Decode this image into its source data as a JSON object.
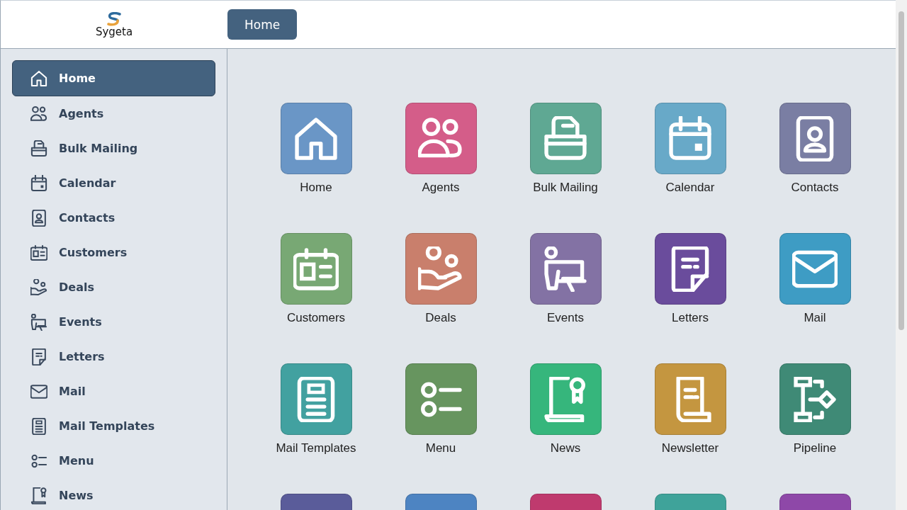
{
  "header": {
    "logo_text": "Sygeta",
    "button": "Home"
  },
  "sidebar": {
    "items": [
      {
        "label": "Home",
        "kind": "home",
        "selected": true
      },
      {
        "label": "Agents",
        "kind": "agents",
        "selected": false
      },
      {
        "label": "Bulk Mailing",
        "kind": "bulk_mailing",
        "selected": false
      },
      {
        "label": "Calendar",
        "kind": "calendar",
        "selected": false
      },
      {
        "label": "Contacts",
        "kind": "contacts",
        "selected": false
      },
      {
        "label": "Customers",
        "kind": "customers",
        "selected": false
      },
      {
        "label": "Deals",
        "kind": "deals",
        "selected": false
      },
      {
        "label": "Events",
        "kind": "events",
        "selected": false
      },
      {
        "label": "Letters",
        "kind": "letters",
        "selected": false
      },
      {
        "label": "Mail",
        "kind": "mail",
        "selected": false
      },
      {
        "label": "Mail Templates",
        "kind": "mail_templates",
        "selected": false
      },
      {
        "label": "Menu",
        "kind": "menu",
        "selected": false
      },
      {
        "label": "News",
        "kind": "news",
        "selected": false
      }
    ]
  },
  "tiles": [
    {
      "label": "Home",
      "kind": "home",
      "color": "#6a96c6"
    },
    {
      "label": "Agents",
      "kind": "agents",
      "color": "#d45d89"
    },
    {
      "label": "Bulk Mailing",
      "kind": "bulk_mailing",
      "color": "#5fa893"
    },
    {
      "label": "Calendar",
      "kind": "calendar",
      "color": "#68a9c8"
    },
    {
      "label": "Contacts",
      "kind": "contacts",
      "color": "#7a7ea3"
    },
    {
      "label": "Customers",
      "kind": "customers",
      "color": "#78a874"
    },
    {
      "label": "Deals",
      "kind": "deals",
      "color": "#c97f6c"
    },
    {
      "label": "Events",
      "kind": "events",
      "color": "#8372a4"
    },
    {
      "label": "Letters",
      "kind": "letters",
      "color": "#6a4c9c"
    },
    {
      "label": "Mail",
      "kind": "mail",
      "color": "#3e9cc4"
    },
    {
      "label": "Mail Templates",
      "kind": "mail_templates",
      "color": "#42a1a0"
    },
    {
      "label": "Menu",
      "kind": "menu",
      "color": "#67955f"
    },
    {
      "label": "News",
      "kind": "news",
      "color": "#36b67c"
    },
    {
      "label": "Newsletter",
      "kind": "newsletter",
      "color": "#c49640"
    },
    {
      "label": "Pipeline",
      "kind": "pipeline",
      "color": "#3f8a76"
    },
    {
      "color": "#5a5c9a"
    },
    {
      "color": "#4d84c2"
    },
    {
      "color": "#bf3a6e"
    },
    {
      "color": "#3fa39a"
    },
    {
      "color": "#8e48a8"
    }
  ]
}
